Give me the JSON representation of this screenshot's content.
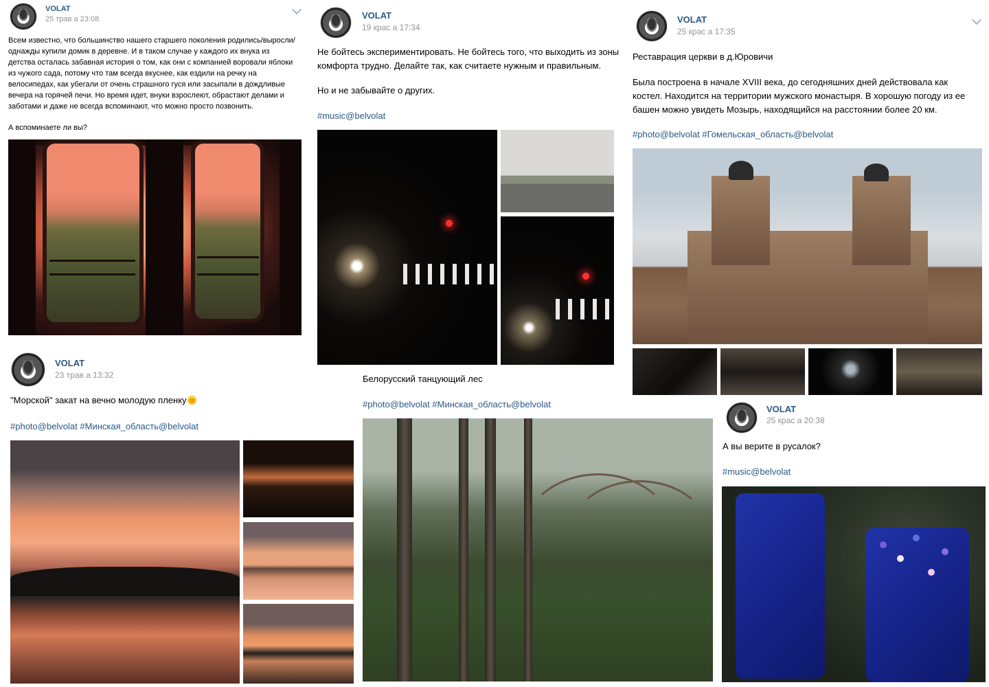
{
  "posts": {
    "p1": {
      "author": "VOLAT",
      "date": "25 трав а 23:08",
      "text": "Всем известно, что большинство нашего старшего поколения родились/выросли/\nоднажды купили домик в деревне. И в таком случае у каждого их внука из\nдетства осталась забавная история о том, как они с компанией воровали яблоки\nиз чужого сада, потому что там всегда вкуснее, как ездили на речку на\nвелосипедах, как убегали от очень страшного гуся или засыпали в дождливые\nвечера на горячей печи. Но время идет, внуки взрослеют, обрастают делами и\nзаботами и даже не всегда вспоминают, что можно просто позвонить.",
      "question": "А вспоминаете ли вы?"
    },
    "p2": {
      "author": "VOLAT",
      "date": "19 крас а 17:34",
      "text": "Не бойтесь экспериментировать. Не бойтесь того, что выходить из зоны\nкомфорта трудно. Делайте так, как считаете нужным и правильным.",
      "text2": "Но и не забывайте о других.",
      "tags": "#music@belvolat"
    },
    "p3": {
      "author": "VOLAT",
      "date": "25 крас а 17:35",
      "title": "Реставрация церкви в д.Юровичи",
      "text": "Была построена в начале XVIII века, до сегодняшних дней действовала как\nкостел. Находится на территории мужского монастыря. В хорошую погоду из ее\nбашен можно увидеть Мозырь, находящийся на расстоянии более 20 км.",
      "tags": "#photo@belvolat #Гомельская_область@belvolat"
    },
    "p4": {
      "author": "VOLAT",
      "date": "23 трав а 13:32",
      "text": "\"Морской\" закат на вечно молодую пленку🌞",
      "tags": "#photo@belvolat #Минская_область@belvolat"
    },
    "p5": {
      "text": "Белорусский танцующий лес",
      "tags": "#photo@belvolat #Минская_область@belvolat"
    },
    "p6": {
      "author": "VOLAT",
      "date": "25 крас а 20:38",
      "text": "А вы верите в русалок?",
      "tags": "#music@belvolat"
    }
  },
  "colors": {
    "link": "#2a5885",
    "date": "#939393"
  },
  "icons": {
    "avatar": "volat-logo",
    "menu": "chevron-down-icon"
  }
}
